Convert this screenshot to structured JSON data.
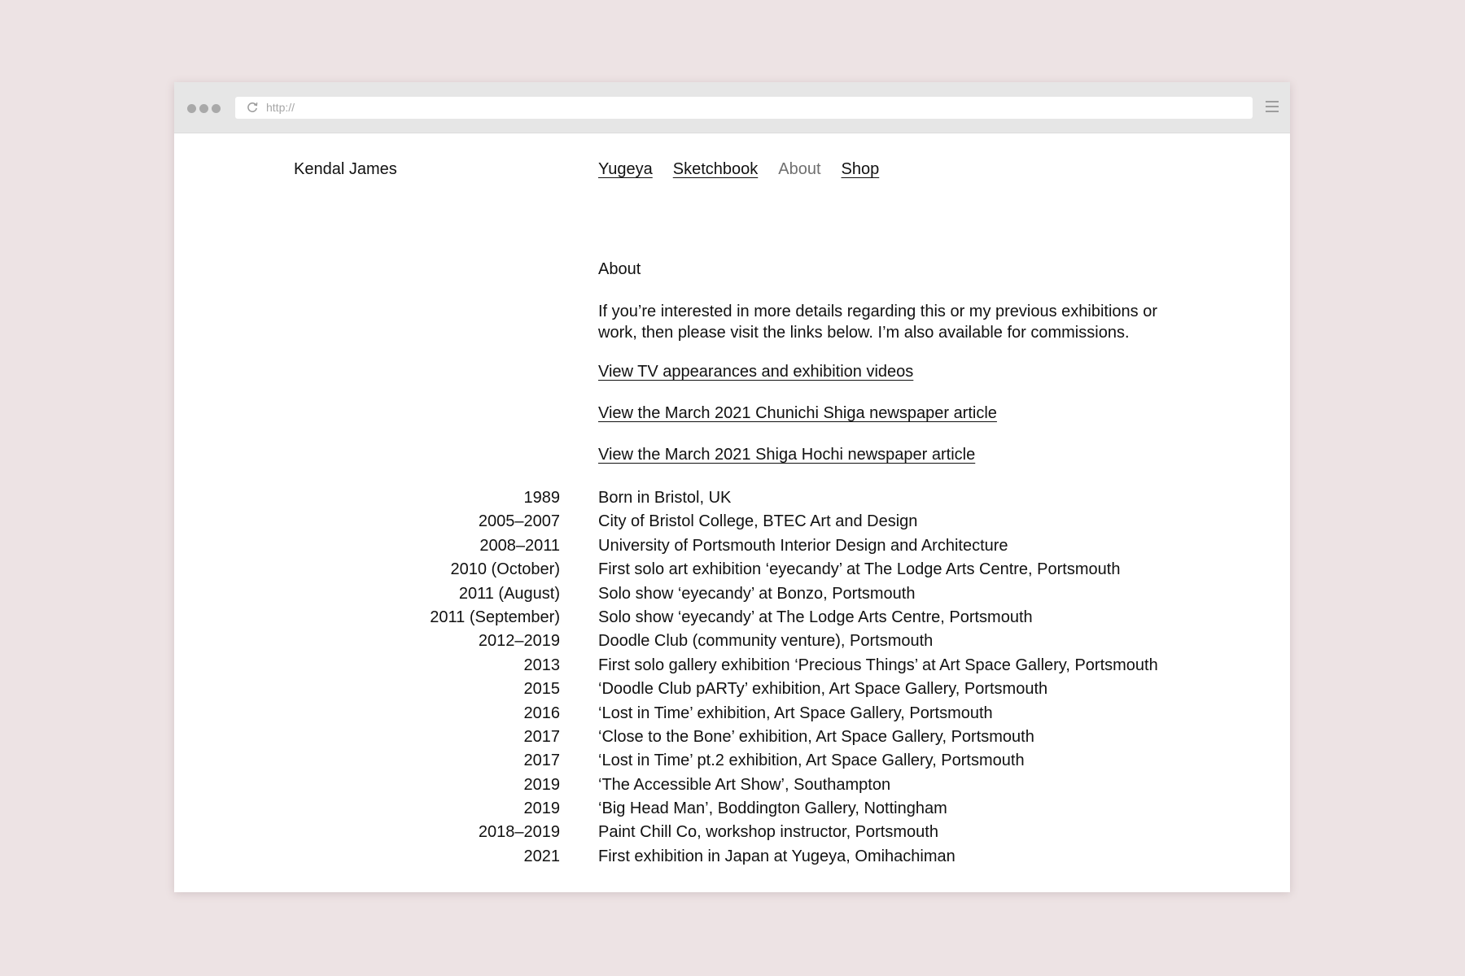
{
  "browser": {
    "url_placeholder": "http://"
  },
  "site": {
    "name": "Kendal James"
  },
  "nav": {
    "items": [
      {
        "label": "Yugeya"
      },
      {
        "label": "Sketchbook"
      },
      {
        "label": "About"
      },
      {
        "label": "Shop"
      }
    ]
  },
  "about": {
    "heading": "About",
    "intro": "If you’re interested in more details regarding this or my previous exhibitions or work, then please visit the links below. I’m also available for commissions.",
    "links": [
      {
        "label": "View TV appearances and exhibition videos"
      },
      {
        "label": "View the March 2021 Chunichi Shiga newspaper article"
      },
      {
        "label": "View the March 2021 Shiga Hochi newspaper article"
      }
    ]
  },
  "timeline": [
    {
      "year": "1989",
      "event": "Born in Bristol, UK"
    },
    {
      "year": "2005–2007",
      "event": "City of Bristol College, BTEC Art and Design"
    },
    {
      "year": "2008–2011",
      "event": "University of Portsmouth Interior Design and Architecture"
    },
    {
      "year": "2010 (October)",
      "event": "First solo art exhibition ‘eyecandy’ at The Lodge Arts Centre, Portsmouth"
    },
    {
      "year": "2011 (August)",
      "event": "Solo show ‘eyecandy’ at Bonzo, Portsmouth"
    },
    {
      "year": "2011 (September)",
      "event": "Solo show ‘eyecandy’ at The Lodge Arts Centre, Portsmouth"
    },
    {
      "year": "2012–2019",
      "event": "Doodle Club (community venture), Portsmouth"
    },
    {
      "year": "2013",
      "event": "First solo gallery exhibition ‘Precious Things’ at Art Space Gallery, Portsmouth"
    },
    {
      "year": "2015",
      "event": "‘Doodle Club pARTy’ exhibition, Art Space Gallery, Portsmouth"
    },
    {
      "year": "2016",
      "event": "‘Lost in Time’ exhibition, Art Space Gallery, Portsmouth"
    },
    {
      "year": "2017",
      "event": "‘Close to the Bone’ exhibition, Art Space Gallery, Portsmouth"
    },
    {
      "year": "2017",
      "event": "‘Lost in Time’ pt.2 exhibition, Art Space Gallery, Portsmouth"
    },
    {
      "year": "2019",
      "event": "‘The Accessible Art Show’, Southampton"
    },
    {
      "year": "2019",
      "event": "‘Big Head Man’, Boddington Gallery, Nottingham"
    },
    {
      "year": "2018–2019",
      "event": "Paint Chill Co, workshop instructor, Portsmouth"
    },
    {
      "year": "2021",
      "event": "First exhibition in Japan at Yugeya, Omihachiman"
    }
  ]
}
